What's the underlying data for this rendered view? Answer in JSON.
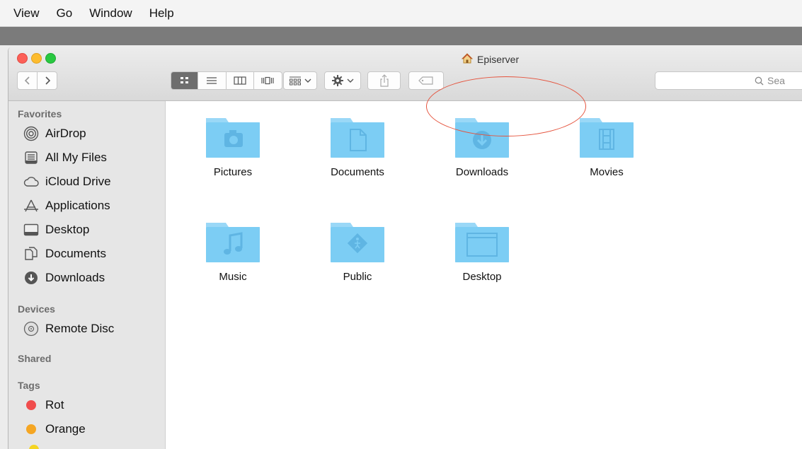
{
  "menu": [
    "View",
    "Go",
    "Window",
    "Help"
  ],
  "window": {
    "title": "Episerver",
    "traffic_lights": {
      "close": "#fc5f57",
      "minimize": "#fdbc2e",
      "zoom": "#28c840"
    }
  },
  "toolbar": {
    "back_icon": "chevron-left-icon",
    "forward_icon": "chevron-right-icon",
    "view_modes": [
      "icon-view-icon",
      "list-view-icon",
      "column-view-icon",
      "cover-flow-icon"
    ],
    "arrange_icon": "arrange-icon",
    "action_icon": "gear-icon",
    "share_icon": "share-icon",
    "tag_icon": "tag-icon",
    "search_placeholder": "Sea"
  },
  "sidebar": {
    "favorites_header": "Favorites",
    "favorites": [
      {
        "label": "AirDrop",
        "icon": "airdrop-icon"
      },
      {
        "label": "All My Files",
        "icon": "all-files-icon"
      },
      {
        "label": "iCloud Drive",
        "icon": "cloud-icon"
      },
      {
        "label": "Applications",
        "icon": "applications-icon"
      },
      {
        "label": "Desktop",
        "icon": "desktop-icon"
      },
      {
        "label": "Documents",
        "icon": "documents-icon"
      },
      {
        "label": "Downloads",
        "icon": "downloads-icon"
      }
    ],
    "devices_header": "Devices",
    "devices": [
      {
        "label": "Remote Disc",
        "icon": "disc-icon"
      }
    ],
    "shared_header": "Shared",
    "tags_header": "Tags",
    "tags": [
      {
        "label": "Rot",
        "color": "#f04d4d"
      },
      {
        "label": "Orange",
        "color": "#f5a623"
      }
    ]
  },
  "folders": [
    {
      "name": "Pictures",
      "icon": "camera-icon"
    },
    {
      "name": "Documents",
      "icon": "document-icon"
    },
    {
      "name": "Downloads",
      "icon": "download-icon"
    },
    {
      "name": "Movies",
      "icon": "film-icon"
    },
    {
      "name": "Music",
      "icon": "music-note-icon"
    },
    {
      "name": "Public",
      "icon": "public-icon"
    },
    {
      "name": "Desktop",
      "icon": "desktop-window-icon"
    }
  ],
  "colors": {
    "folder": "#7ccdf4",
    "folder_tab": "#9ad8f7",
    "folder_glyph": "#5fb5e3",
    "annotation": "#e5533d"
  }
}
